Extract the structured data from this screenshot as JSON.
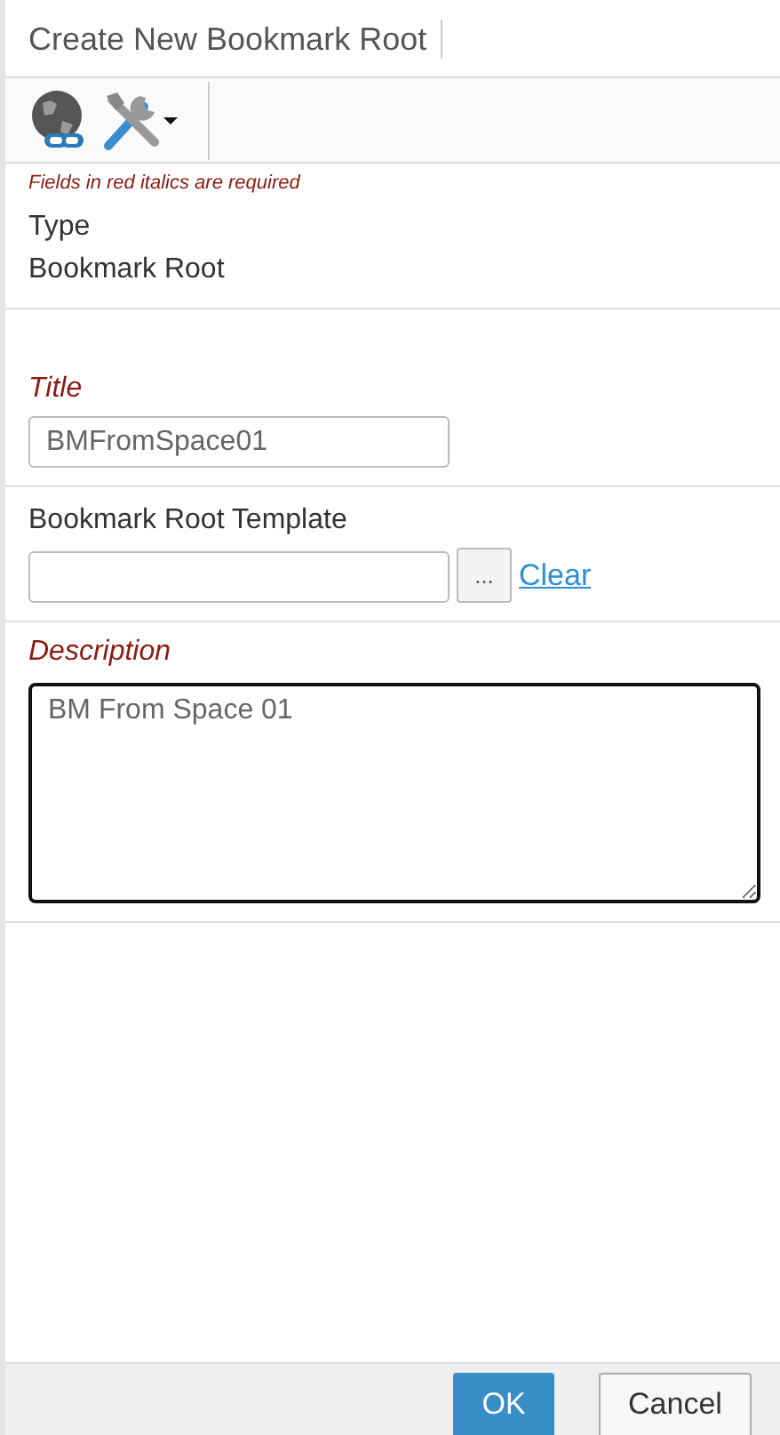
{
  "window": {
    "title": "Create New Bookmark Root"
  },
  "toolbar": {
    "items": [
      {
        "kind": "globe-link"
      },
      {
        "kind": "tools-menu"
      }
    ]
  },
  "note": "Fields in red italics are required",
  "fields": [
    {
      "kind": "readonly",
      "label": "Type",
      "value": "Bookmark Root",
      "required": false
    },
    {
      "kind": "text",
      "label": "Title",
      "value": "BMFromSpace01",
      "required": true
    },
    {
      "kind": "lookup",
      "label": "Bookmark Root Template",
      "browse": "...",
      "clear": "Clear",
      "required": false
    },
    {
      "kind": "textarea",
      "label": "Description",
      "value": "BM From Space 01",
      "required": true,
      "focused": true
    }
  ],
  "buttons": [
    {
      "label": "OK",
      "primary": true
    },
    {
      "label": "Cancel",
      "primary": false
    }
  ]
}
